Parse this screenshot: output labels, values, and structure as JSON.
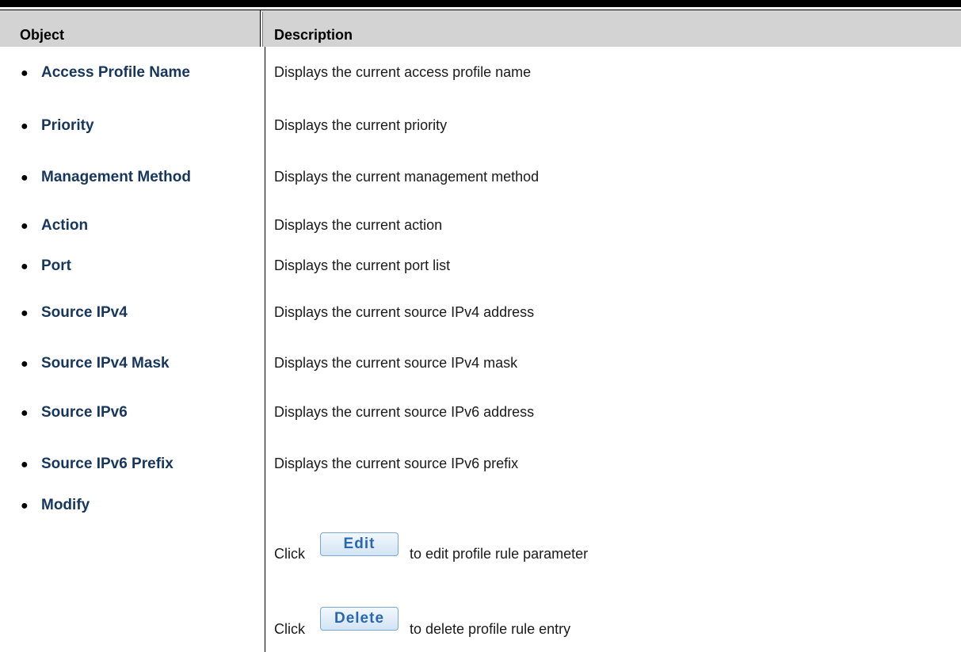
{
  "table": {
    "headers": {
      "object": "Object",
      "description": "Description"
    },
    "rows": [
      {
        "object": "Access Profile Name",
        "description": "Displays the current access profile name"
      },
      {
        "object": "Priority",
        "description": "Displays the current priority"
      },
      {
        "object": "Management Method",
        "description": "Displays the current management method"
      },
      {
        "object": "Action",
        "description": "Displays the current action"
      },
      {
        "object": "Port",
        "description": "Displays the current port list"
      },
      {
        "object": "Source IPv4",
        "description": "Displays the current source IPv4 address"
      },
      {
        "object": "Source IPv4 Mask",
        "description": "Displays the current source IPv4 mask"
      },
      {
        "object": "Source IPv6",
        "description": "Displays the current source IPv6 address"
      },
      {
        "object": "Source IPv6 Prefix",
        "description": "Displays the current source IPv6 prefix"
      }
    ],
    "modify": {
      "object": "Modify",
      "edit_prefix": "Click",
      "edit_button": "Edit",
      "edit_suffix": "to edit profile rule parameter",
      "delete_prefix": "Click",
      "delete_button": "Delete",
      "delete_suffix": "to delete profile rule entry"
    }
  }
}
